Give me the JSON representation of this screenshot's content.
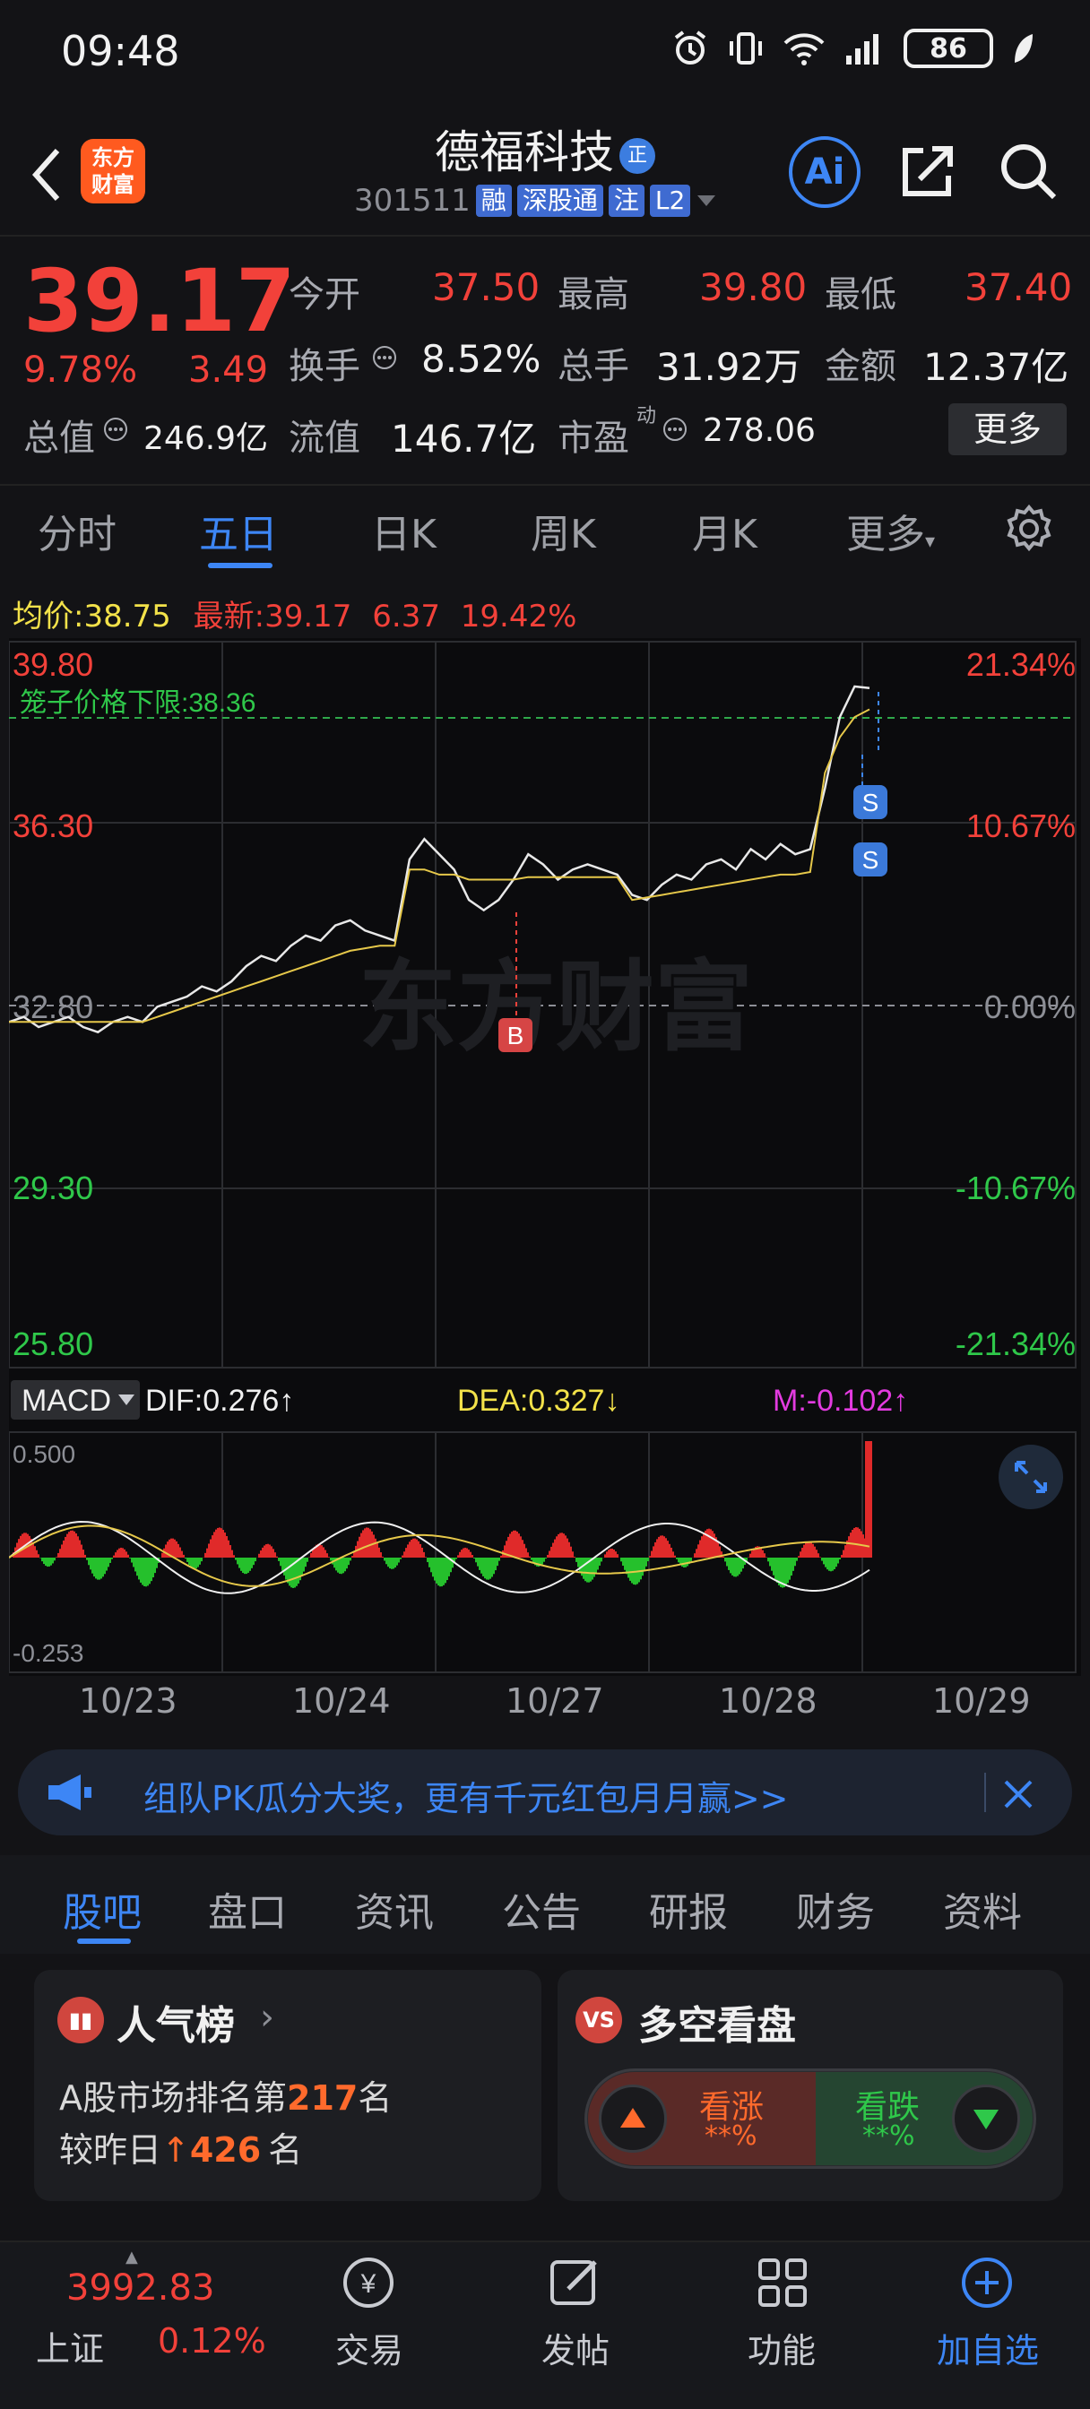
{
  "status_bar": {
    "time": "09:48",
    "battery": "86"
  },
  "header": {
    "logo_text_1": "东方",
    "logo_text_2": "财富",
    "stock_name": "德福科技",
    "badge": "正",
    "code": "301511",
    "tags": [
      "融",
      "深股通",
      "注",
      "L2"
    ],
    "ai_label": "Ai"
  },
  "quote": {
    "price": "39.17",
    "change_pct": "9.78%",
    "change": "3.49",
    "open_label": "今开",
    "open": "37.50",
    "high_label": "最高",
    "high": "39.80",
    "low_label": "最低",
    "low": "37.40",
    "turnover_label": "换手",
    "turnover": "8.52%",
    "volume_label": "总手",
    "volume": "31.92万",
    "amount_label": "金额",
    "amount": "12.37亿",
    "total_value_label": "总值",
    "total_value": "246.9亿",
    "float_value_label": "流值",
    "float_value": "146.7亿",
    "pe_label": "市盈",
    "pe_sup": "动",
    "pe": "278.06",
    "more": "更多"
  },
  "chart_tabs": [
    "分时",
    "五日",
    "日K",
    "周K",
    "月K",
    "更多"
  ],
  "info_line": {
    "avg_label": "均价:",
    "avg": "38.75",
    "latest_label": "最新:",
    "latest": "39.17",
    "chg": "6.37",
    "pct": "19.42%"
  },
  "chart_data": {
    "type": "line",
    "cage_label": "笼子价格下限:",
    "cage_value": "38.36",
    "watermark": "东方财富",
    "y_left_labels": [
      "39.80",
      "36.30",
      "32.80",
      "29.30",
      "25.80"
    ],
    "y_right_labels": [
      "21.34%",
      "10.67%",
      "0.00%",
      "-10.67%",
      "-21.34%"
    ],
    "ylim": [
      25.8,
      39.8
    ],
    "x_labels": [
      "10/23",
      "10/24",
      "10/27",
      "10/28",
      "10/29"
    ],
    "markers": [
      "B",
      "S",
      "S"
    ],
    "series": [
      {
        "name": "price",
        "values": [
          32.6,
          32.7,
          32.5,
          32.6,
          32.7,
          32.5,
          32.4,
          32.6,
          32.7,
          32.6,
          32.9,
          33.0,
          33.1,
          33.3,
          33.2,
          33.4,
          33.7,
          33.9,
          33.8,
          34.1,
          34.3,
          34.2,
          34.5,
          34.6,
          34.4,
          34.3,
          34.2,
          35.8,
          36.2,
          35.9,
          35.6,
          35.0,
          34.8,
          35.0,
          35.4,
          35.9,
          35.7,
          35.4,
          35.6,
          35.7,
          35.6,
          35.5,
          35.1,
          35.0,
          35.3,
          35.5,
          35.4,
          35.7,
          35.8,
          35.6,
          36.0,
          35.8,
          36.1,
          35.9,
          36.0,
          37.2,
          38.6,
          39.2,
          39.17
        ]
      },
      {
        "name": "avg",
        "values": [
          32.6,
          32.6,
          32.6,
          32.6,
          32.6,
          32.6,
          32.6,
          32.6,
          32.6,
          32.6,
          32.7,
          32.8,
          32.9,
          33.0,
          33.1,
          33.2,
          33.3,
          33.4,
          33.5,
          33.6,
          33.7,
          33.8,
          33.9,
          34.0,
          34.05,
          34.1,
          34.1,
          35.6,
          35.6,
          35.5,
          35.5,
          35.4,
          35.4,
          35.4,
          35.4,
          35.45,
          35.45,
          35.45,
          35.45,
          35.45,
          35.45,
          35.45,
          35.0,
          35.05,
          35.1,
          35.15,
          35.2,
          35.25,
          35.3,
          35.35,
          35.4,
          35.45,
          35.5,
          35.5,
          35.55,
          37.5,
          38.2,
          38.6,
          38.75
        ]
      }
    ]
  },
  "macd": {
    "label": "MACD",
    "dif": "DIF:0.276↑",
    "dea": "DEA:0.327↓",
    "m": "M:-0.102↑",
    "top": "0.500",
    "bottom": "-0.253"
  },
  "banner": {
    "text": "组队PK瓜分大奖，更有千元红包月月赢>>"
  },
  "info_tabs": [
    "股吧",
    "盘口",
    "资讯",
    "公告",
    "研报",
    "财务",
    "资料"
  ],
  "cards": {
    "popularity": {
      "title": "人气榜",
      "rank_prefix": "A股市场排名第",
      "rank": "217",
      "rank_suffix": "名",
      "change_prefix": "较昨日",
      "change": "426",
      "change_suffix": "名"
    },
    "sentiment": {
      "title": "多空看盘",
      "bull": "看涨",
      "bull_val": "**%",
      "bear": "看跌",
      "bear_val": "**%"
    }
  },
  "bottom_nav": {
    "index_value": "3992.83",
    "index_name": "上证",
    "index_pct": "0.12%",
    "items": [
      "交易",
      "发帖",
      "功能",
      "加自选"
    ]
  }
}
